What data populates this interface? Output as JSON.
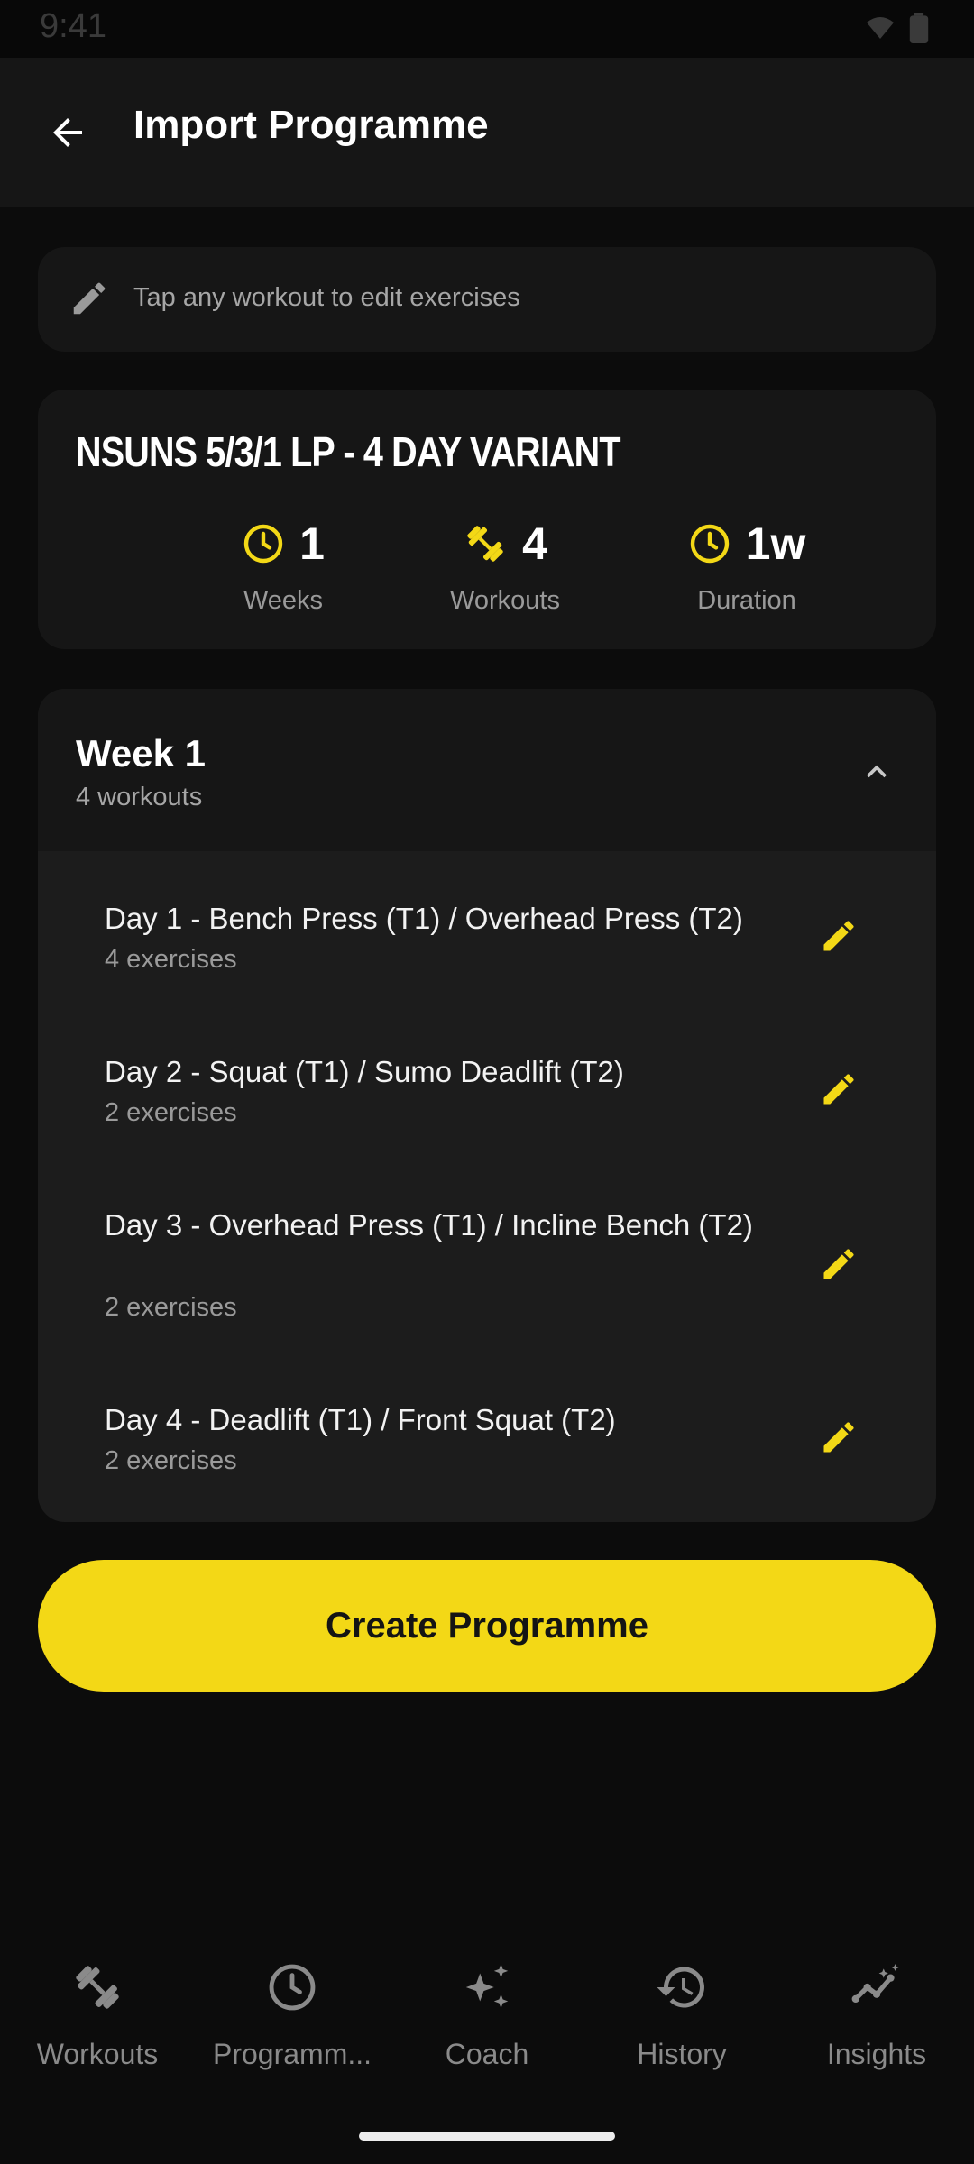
{
  "status_bar": {
    "time": "9:41"
  },
  "app_bar": {
    "title": "Import Programme"
  },
  "hint": {
    "text": "Tap any workout to edit exercises"
  },
  "programme": {
    "title": "NSUNS 5/3/1 LP - 4 DAY VARIANT",
    "stats": [
      {
        "value": "1",
        "label": "Weeks",
        "icon": "clock-icon"
      },
      {
        "value": "4",
        "label": "Workouts",
        "icon": "dumbbell-icon"
      },
      {
        "value": "1w",
        "label": "Duration",
        "icon": "clock-icon"
      }
    ]
  },
  "week": {
    "title": "Week 1",
    "subtitle": "4 workouts",
    "workouts": [
      {
        "name": "Day 1 - Bench Press (T1) / Overhead Press (T2)",
        "exercises": "4 exercises"
      },
      {
        "name": "Day 2 - Squat (T1) / Sumo Deadlift (T2)",
        "exercises": "2 exercises"
      },
      {
        "name": "Day 3 - Overhead Press (T1) / Incline Bench (T2)",
        "exercises": "2 exercises"
      },
      {
        "name": "Day 4 - Deadlift (T1) / Front Squat (T2)",
        "exercises": "2 exercises"
      }
    ]
  },
  "create_button": {
    "label": "Create Programme"
  },
  "nav": {
    "items": [
      {
        "label": "Workouts",
        "icon": "dumbbell-icon"
      },
      {
        "label": "Programm...",
        "icon": "clock-icon"
      },
      {
        "label": "Coach",
        "icon": "sparkle-icon"
      },
      {
        "label": "History",
        "icon": "history-icon"
      },
      {
        "label": "Insights",
        "icon": "insights-icon"
      }
    ]
  },
  "colors": {
    "accent": "#f3d816",
    "background": "#0c0c0c",
    "card": "#161616"
  }
}
